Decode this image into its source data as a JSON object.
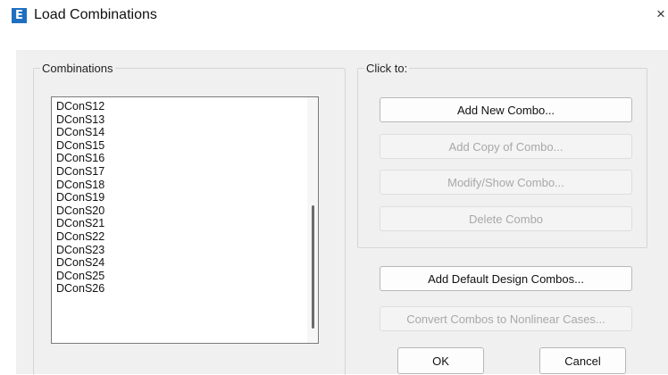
{
  "window": {
    "app_icon_letter": "E",
    "title": "Load Combinations",
    "close_glyph": "×"
  },
  "combinations": {
    "label": "Combinations",
    "items": [
      "DConS12",
      "DConS13",
      "DConS14",
      "DConS15",
      "DConS16",
      "DConS17",
      "DConS18",
      "DConS19",
      "DConS20",
      "DConS21",
      "DConS22",
      "DConS23",
      "DConS24",
      "DConS25",
      "DConS26"
    ]
  },
  "click_to": {
    "label": "Click to:",
    "add_new": "Add New Combo...",
    "add_copy": "Add Copy of Combo...",
    "modify_show": "Modify/Show Combo...",
    "delete": "Delete Combo"
  },
  "actions": {
    "add_default_design": "Add Default Design Combos...",
    "convert_nonlinear": "Convert Combos to Nonlinear Cases...",
    "ok": "OK",
    "cancel": "Cancel"
  }
}
